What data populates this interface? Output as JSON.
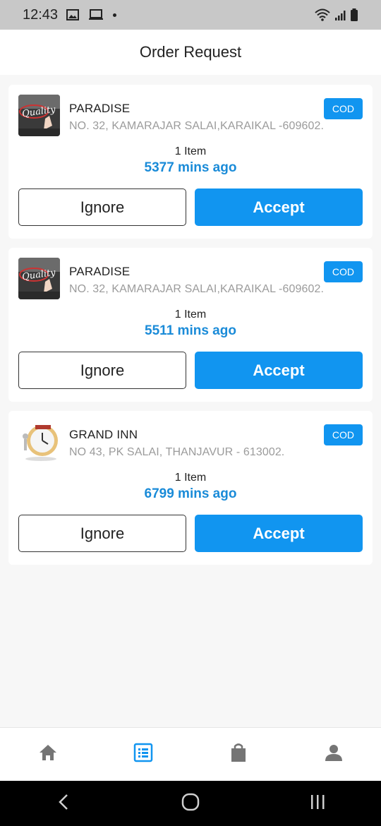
{
  "status_bar": {
    "time": "12:43",
    "icons": [
      "image-icon",
      "cast-icon",
      "dot-icon",
      "wifi-icon",
      "signal-icon",
      "battery-icon"
    ]
  },
  "header": {
    "title": "Order Request"
  },
  "orders": [
    {
      "name": "PARADISE",
      "address": "NO. 32, KAMARAJAR SALAI,KARAIKAL -609602.",
      "payment": "COD",
      "items": "1 Item",
      "time_ago": "5377 mins ago",
      "ignore_label": "Ignore",
      "accept_label": "Accept",
      "thumb": "quality-logo"
    },
    {
      "name": "PARADISE",
      "address": "NO. 32, KAMARAJAR SALAI,KARAIKAL -609602.",
      "payment": "COD",
      "items": "1 Item",
      "time_ago": "5511 mins ago",
      "ignore_label": "Ignore",
      "accept_label": "Accept",
      "thumb": "quality-logo"
    },
    {
      "name": "GRAND INN",
      "address": "NO  43, PK SALAI, THANJAVUR - 613002.",
      "payment": "COD",
      "items": "1 Item",
      "time_ago": "6799 mins ago",
      "ignore_label": "Ignore",
      "accept_label": "Accept",
      "thumb": "clock-logo"
    }
  ],
  "bottom_nav": {
    "items": [
      {
        "icon": "home-icon",
        "active": false
      },
      {
        "icon": "list-icon",
        "active": true
      },
      {
        "icon": "shopping-bag-icon",
        "active": false
      },
      {
        "icon": "person-icon",
        "active": false
      }
    ]
  },
  "colors": {
    "accent": "#1195f0",
    "time_ago": "#1a8bd8",
    "address": "#9b9b9b",
    "nav_inactive": "#757575"
  }
}
